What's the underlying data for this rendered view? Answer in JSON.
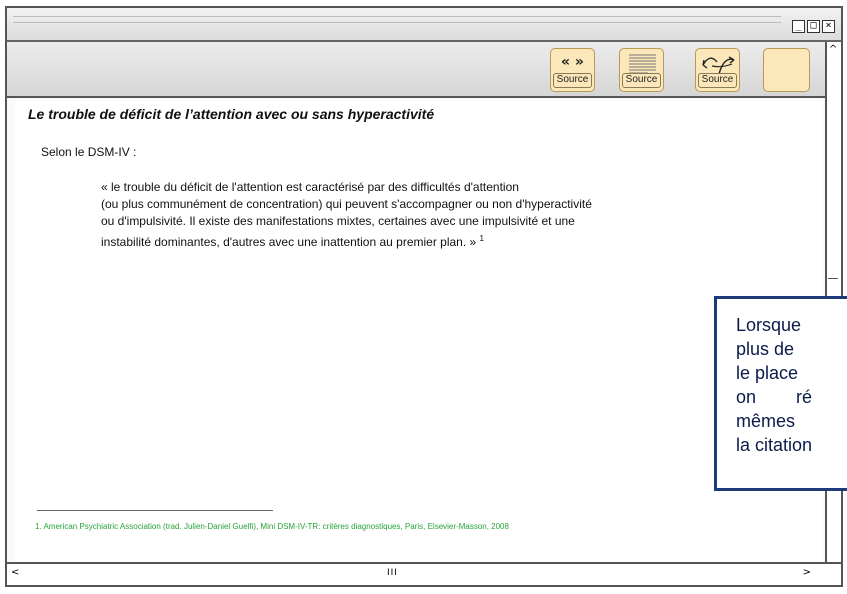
{
  "window": {
    "controls": [
      "minimize-icon",
      "maximize-icon",
      "close-icon"
    ]
  },
  "toolbar": {
    "buttons": [
      {
        "label": "Source",
        "icon": "guillemets-icon",
        "glyph": "«  »"
      },
      {
        "label": "Source",
        "icon": "document-thumbnail-icon"
      },
      {
        "label": "Source",
        "icon": "curved-arrows-icon"
      },
      {
        "label": "",
        "icon": ""
      }
    ]
  },
  "content": {
    "title": "Le trouble de déficit de l’attention avec ou sans hyperactivité",
    "intro": "Selon le DSM-IV :",
    "quote_lines": [
      "« le trouble du déficit de l'attention est  caractérisé par des difficultés d'attention",
      "(ou plus communément de concentration) qui peuvent  s'accompagner ou non d'hyperactivité",
      "ou d'impulsivité. Il existe des manifestations mixtes,  certaines avec une impulsivité et une",
      "instabilité dominantes, d'autres avec une inattention au premier plan. »"
    ],
    "quote_footnote_mark": "1",
    "footnote": "1. American Psychiatric Association (trad. Julien-Daniel Guelfi), Mini DSM-IV-TR: critères diagnostiques, Paris, Elsevier-Masson, 2008"
  },
  "callout": {
    "lines": [
      "Lorsque",
      "plus de",
      "le place",
      "on        ré",
      "mêmes",
      "la citation"
    ]
  },
  "colors": {
    "footnote": "#27a43a",
    "callout_border": "#1d3a7a",
    "source_button": "#fbe7b9"
  }
}
